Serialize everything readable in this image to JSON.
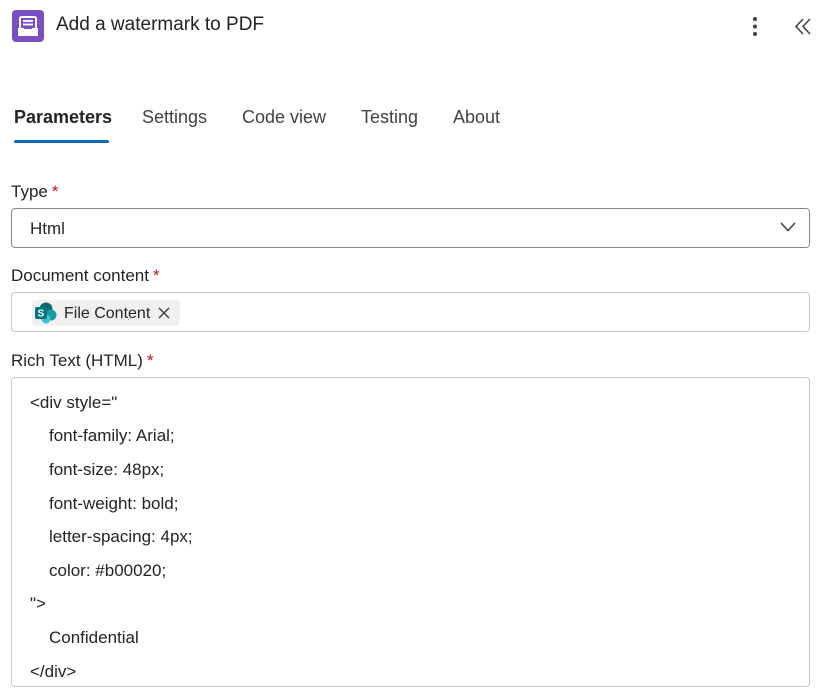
{
  "header": {
    "title": "Add a watermark to PDF",
    "app_icon": "inbox-tray-icon",
    "more_icon": "more-vertical-icon",
    "collapse_icon": "double-chevron-left-icon",
    "accent": "#7a4fc4"
  },
  "tabs": [
    {
      "label": "Parameters",
      "active": true
    },
    {
      "label": "Settings",
      "active": false
    },
    {
      "label": "Code view",
      "active": false
    },
    {
      "label": "Testing",
      "active": false
    },
    {
      "label": "About",
      "active": false
    }
  ],
  "fields": {
    "type": {
      "label": "Type",
      "required_mark": "*",
      "value": "Html"
    },
    "document_content": {
      "label": "Document content",
      "required_mark": "*",
      "token_label": "File Content",
      "token_icon": "sharepoint-icon"
    },
    "rich_text": {
      "label": "Rich Text (HTML)",
      "required_mark": "*",
      "lines": [
        "<div style=\"",
        "font-family: Arial;",
        "font-size: 48px;",
        "font-weight: bold;",
        "letter-spacing: 4px;",
        "color: #b00020;",
        "\">",
        "Confidential",
        "</div>"
      ]
    }
  },
  "colors": {
    "tab_underline": "#0f6cbd",
    "required": "#c50f1f"
  }
}
